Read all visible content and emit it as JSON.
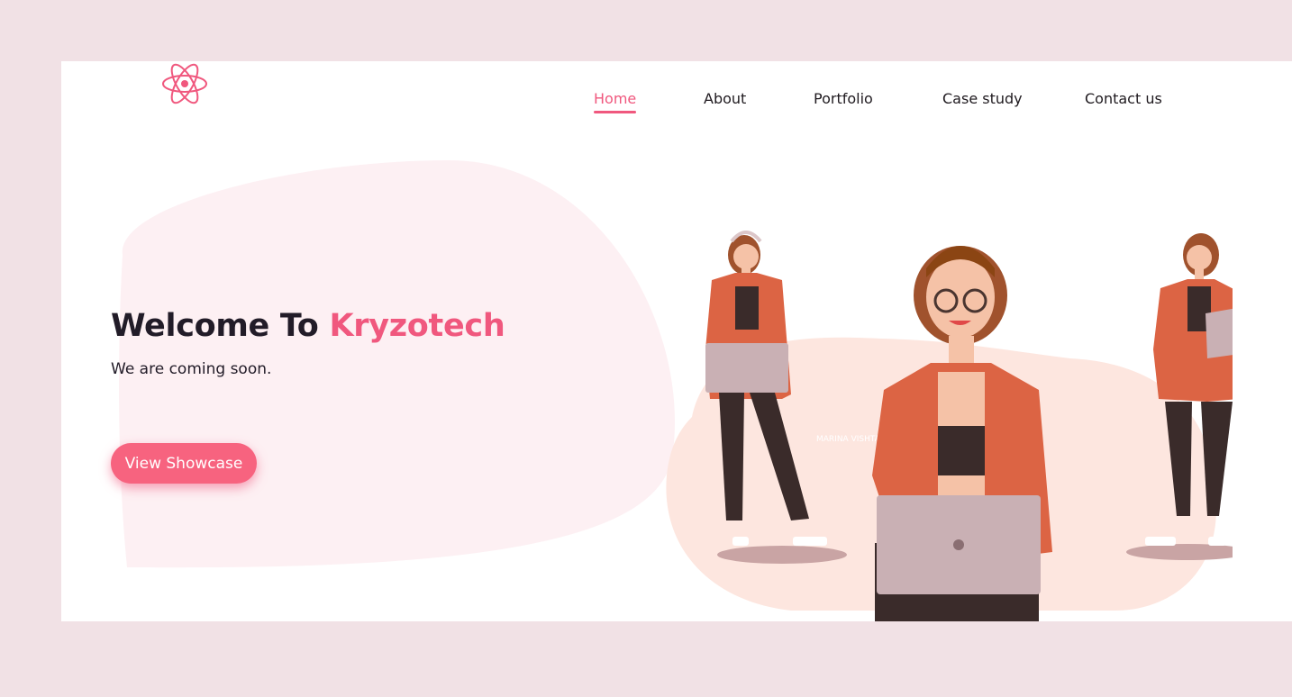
{
  "nav": {
    "items": [
      {
        "label": "Home",
        "active": true
      },
      {
        "label": "About",
        "active": false
      },
      {
        "label": "Portfolio",
        "active": false
      },
      {
        "label": "Case study",
        "active": false
      },
      {
        "label": "Contact us",
        "active": false
      }
    ]
  },
  "hero": {
    "title_prefix": "Welcome To ",
    "title_brand": "Kryzotech",
    "subtitle": "We are coming soon.",
    "cta_label": "View Showcase"
  },
  "illustration": {
    "signature": "MARINA VISHTAK"
  },
  "colors": {
    "accent": "#f0587e",
    "page_background": "#f1e1e5",
    "blob": "#fdf0f3",
    "jacket": "#dc6444",
    "laptop": "#c9b0b4"
  },
  "icons": {
    "logo": "atom-icon"
  }
}
